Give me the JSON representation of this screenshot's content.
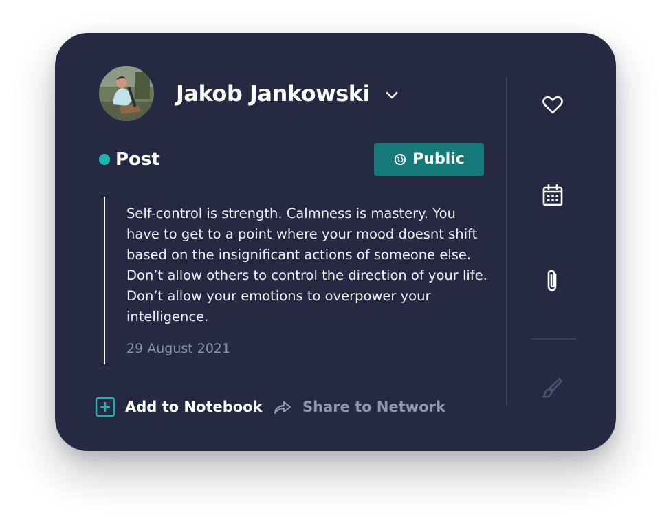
{
  "post": {
    "author": {
      "name": "Jakob Jankowski",
      "avatar_icon": "avatar-photo"
    },
    "type_label": "Post",
    "type_dot_color": "#1ab3ad",
    "visibility": {
      "label": "Public",
      "icon": "globe-icon",
      "color": "#167a7a"
    },
    "quote": "Self-control is strength. Calmness is mastery. You have to get to a point where your mood doesnt shift based on the insignificant actions of someone else. Don’t allow others to control the direction of your life. Don’t allow your emotions to overpower your intelligence.",
    "date": "29 August 2021"
  },
  "actions": {
    "add": {
      "label": "Add to Notebook",
      "icon": "plus-square-icon",
      "color": "#1ab3ad"
    },
    "share": {
      "label": "Share to Network",
      "icon": "share-icon"
    }
  },
  "sidebar": {
    "icons": [
      "heart-icon",
      "calendar-icon",
      "paperclip-icon",
      "brush-icon"
    ]
  },
  "colors": {
    "card_background": "#252a42",
    "accent": "#1ab3ad"
  }
}
